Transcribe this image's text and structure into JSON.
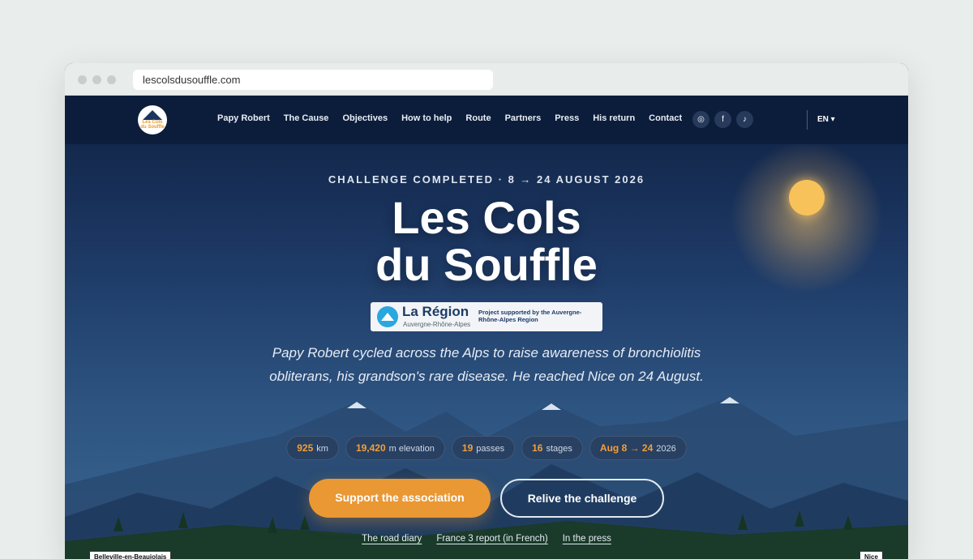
{
  "browser": {
    "url": "lescolsdusouffle.com"
  },
  "nav": {
    "logo_top": "Les Cols",
    "logo_bottom": "du Souffle",
    "links": [
      "Papy Robert",
      "The Cause",
      "Objectives",
      "How to help",
      "Route",
      "Partners",
      "Press",
      "His return",
      "Contact"
    ],
    "socials": [
      {
        "icon": "instagram-icon",
        "glyph": "◎"
      },
      {
        "icon": "facebook-icon",
        "glyph": "f"
      },
      {
        "icon": "tiktok-icon",
        "glyph": "♪"
      }
    ],
    "language": "EN ▾"
  },
  "hero": {
    "kicker": "CHALLENGE COMPLETED · 8 → 24 AUGUST 2026",
    "title_line1": "Les Cols",
    "title_line2": "du Souffle",
    "region": {
      "name": "La Région",
      "sub": "Auvergne-Rhône-Alpes",
      "note": "Project supported by the Auvergne-Rhône-Alpes Region"
    },
    "lead": "Papy Robert cycled across the Alps to raise awareness of bronchiolitis obliterans, his grandson's rare disease. He reached Nice on 24 August.",
    "stats": [
      {
        "value": "925",
        "label": "km"
      },
      {
        "value": "19,420",
        "label": "m elevation"
      },
      {
        "value": "19",
        "label": "passes"
      },
      {
        "value": "16",
        "label": "stages"
      },
      {
        "value": "Aug 8 → 24",
        "label": "2026"
      }
    ],
    "primary_cta": "Support the association",
    "secondary_cta": "Relive the challenge",
    "links": [
      "The road diary",
      "France 3 report (in French)",
      "In the press"
    ],
    "route_start": "Belleville-en-Beaujolais",
    "route_end": "Nice"
  },
  "colors": {
    "accent": "#ea9833",
    "navy": "#0f2142",
    "sun": "#f7c25a"
  }
}
